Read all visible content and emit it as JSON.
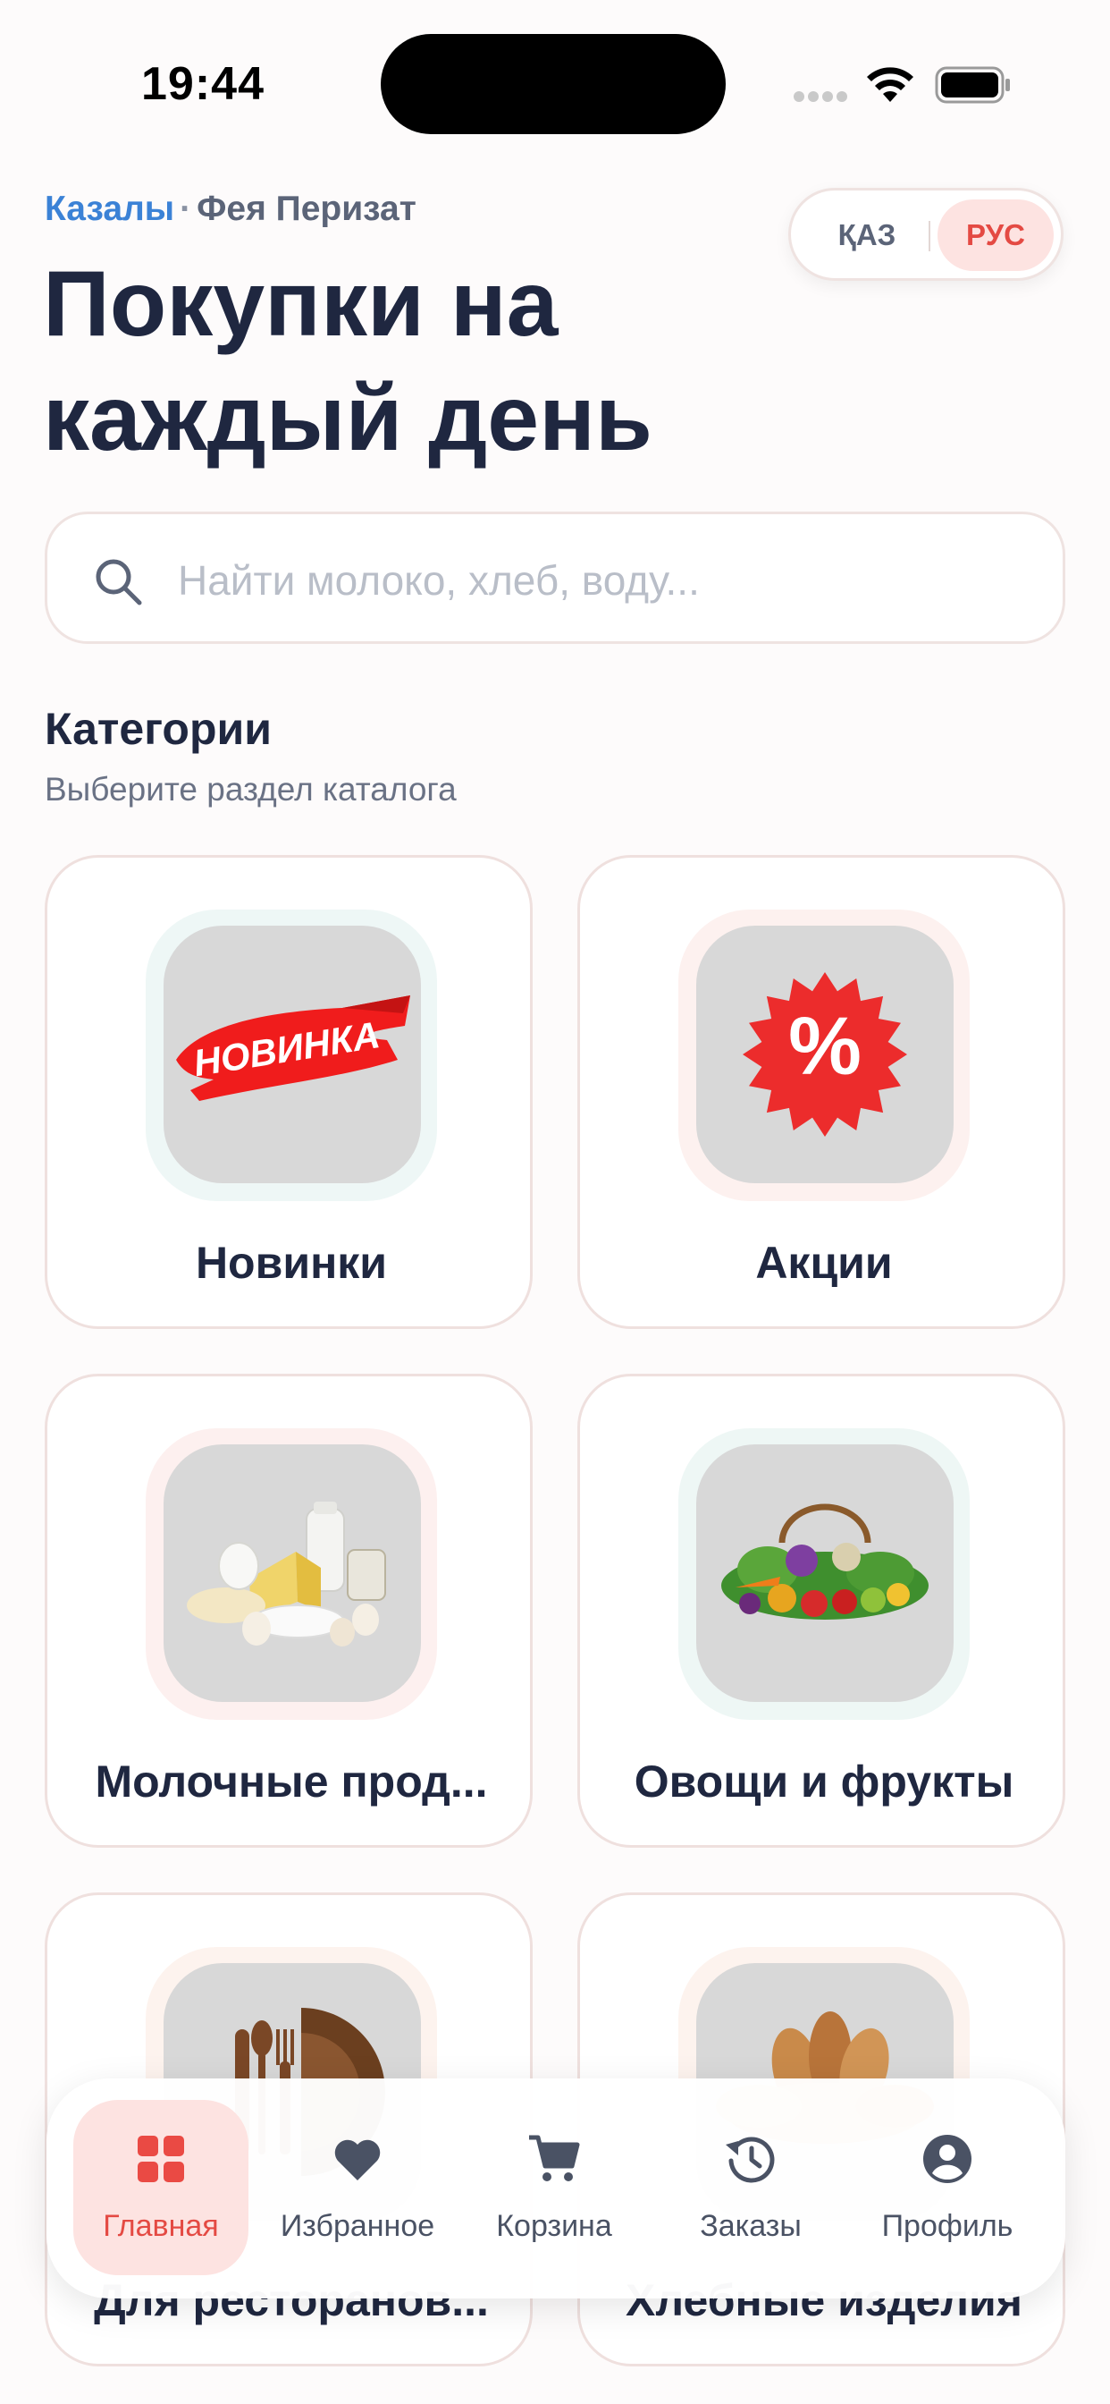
{
  "status_bar": {
    "time": "19:44"
  },
  "header": {
    "city": "Казалы",
    "separator": "·",
    "store": "Фея Перизат",
    "title": "Покупки на каждый день",
    "languages": [
      {
        "label": "ҚАЗ",
        "active": false
      },
      {
        "label": "РУС",
        "active": true
      }
    ]
  },
  "search": {
    "placeholder": "Найти молоко, хлеб, воду...",
    "value": ""
  },
  "categories": {
    "title": "Категории",
    "subtitle": "Выберите раздел каталога",
    "items": [
      {
        "label": "Новинки",
        "icon": "new-badge-image",
        "halo": "#eef7f6",
        "badge_text": "НОВИНКА"
      },
      {
        "label": "Акции",
        "icon": "discount-percent-image",
        "halo": "#fdf1ef"
      },
      {
        "label": "Молочные прод...",
        "icon": "dairy-products-image",
        "halo": "#fdf0ef"
      },
      {
        "label": "Овощи и фрукты",
        "icon": "vegetables-fruits-image",
        "halo": "#eef7f5"
      },
      {
        "label": "Для ресторанов...",
        "icon": "restaurant-cutlery-image",
        "halo": "#fdf3ee"
      },
      {
        "label": "Хлебные изделия",
        "icon": "bakery-bread-image",
        "halo": "#fdf3ee"
      }
    ]
  },
  "bottom_nav": {
    "items": [
      {
        "label": "Главная",
        "icon": "home-grid-icon",
        "active": true
      },
      {
        "label": "Избранное",
        "icon": "heart-icon",
        "active": false
      },
      {
        "label": "Корзина",
        "icon": "cart-icon",
        "active": false
      },
      {
        "label": "Заказы",
        "icon": "history-icon",
        "active": false
      },
      {
        "label": "Профиль",
        "icon": "profile-icon",
        "active": false
      }
    ]
  },
  "colors": {
    "accent": "#e44a43",
    "accent_soft": "#fde3e1",
    "link": "#3b82d6",
    "text_primary": "#1f2740",
    "card_border": "#efe0de"
  }
}
